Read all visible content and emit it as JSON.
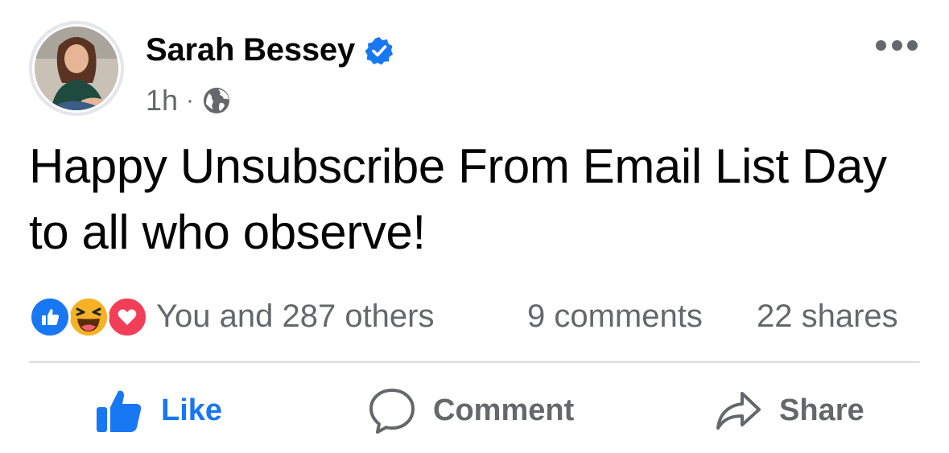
{
  "post": {
    "author": "Sarah Bessey",
    "verified": true,
    "time": "1h",
    "separator": "·",
    "audience_icon": "globe-icon",
    "more_icon": "more-options-icon",
    "text": "Happy Unsubscribe From Email List Day to all who observe!"
  },
  "stats": {
    "reactions": [
      "like-reaction-icon",
      "haha-reaction-icon",
      "love-reaction-icon"
    ],
    "reaction_summary": "You and 287 others",
    "comments": "9 comments",
    "shares": "22 shares"
  },
  "actions": {
    "like": "Like",
    "comment": "Comment",
    "share": "Share"
  },
  "colors": {
    "brand_blue": "#1877f2",
    "secondary_text": "#65676b",
    "love_red": "#f33e58",
    "haha_yellow": "#f7b125"
  }
}
